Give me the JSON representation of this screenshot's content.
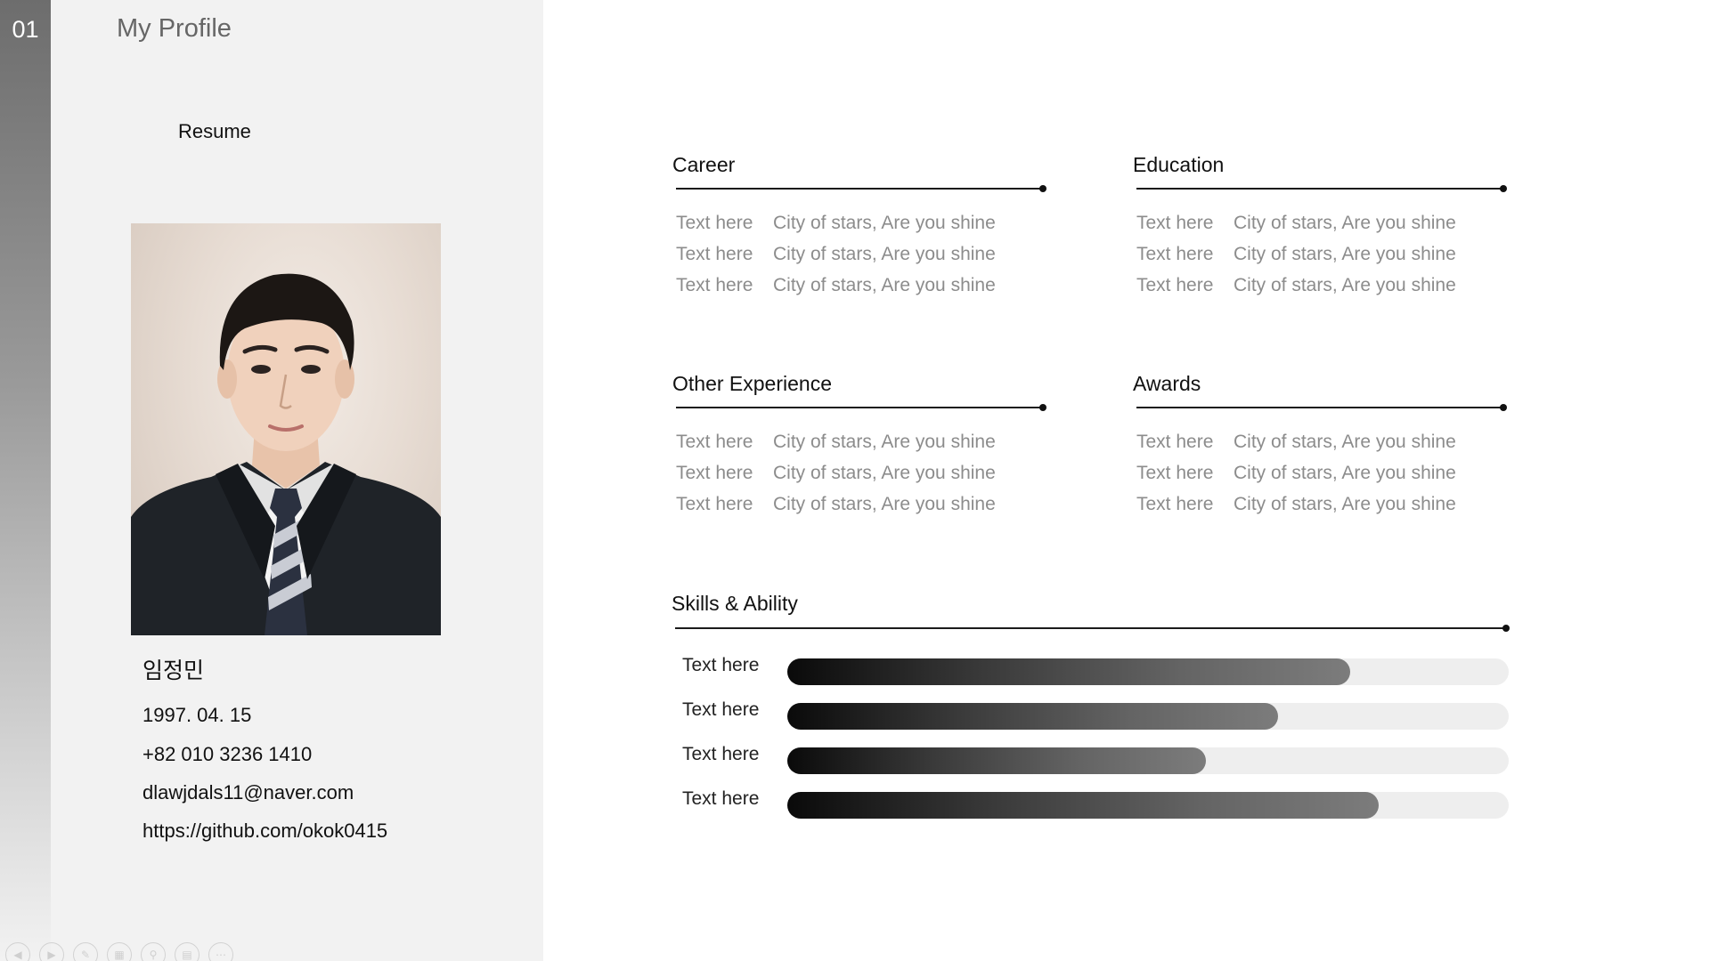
{
  "slide": {
    "number": "01",
    "title": "My Profile"
  },
  "resume_label": "Resume",
  "profile": {
    "name": "임정민",
    "birth": "1997. 04. 15",
    "phone": "+82 010 3236 1410",
    "email": "dlawjdals11@naver.com",
    "github": "https://github.com/okok0415"
  },
  "sections": {
    "career": {
      "title": "Career",
      "rows": [
        {
          "label": "Text here",
          "value": "City of stars, Are you shine"
        },
        {
          "label": "Text here",
          "value": "City of stars, Are you shine"
        },
        {
          "label": "Text here",
          "value": "City of stars, Are you shine"
        }
      ]
    },
    "education": {
      "title": "Education",
      "rows": [
        {
          "label": "Text here",
          "value": "City of stars, Are you shine"
        },
        {
          "label": "Text here",
          "value": "City of stars, Are you shine"
        },
        {
          "label": "Text here",
          "value": "City of stars, Are you shine"
        }
      ]
    },
    "other": {
      "title": "Other Experience",
      "rows": [
        {
          "label": "Text here",
          "value": "City of stars, Are you shine"
        },
        {
          "label": "Text here",
          "value": "City of stars, Are you shine"
        },
        {
          "label": "Text here",
          "value": "City of stars, Are you shine"
        }
      ]
    },
    "awards": {
      "title": "Awards",
      "rows": [
        {
          "label": "Text here",
          "value": "City of stars, Are you shine"
        },
        {
          "label": "Text here",
          "value": "City of stars, Are you shine"
        },
        {
          "label": "Text here",
          "value": "City of stars, Are you shine"
        }
      ]
    }
  },
  "skills": {
    "title": "Skills & Ability",
    "items": [
      {
        "label": "Text here",
        "level": 0.78
      },
      {
        "label": "Text here",
        "level": 0.68
      },
      {
        "label": "Text here",
        "level": 0.58
      },
      {
        "label": "Text here",
        "level": 0.82
      }
    ]
  },
  "toolbar": {
    "icons": [
      "previous-icon",
      "next-icon",
      "pen-icon",
      "slides-icon",
      "zoom-icon",
      "subtitles-icon",
      "more-icon"
    ]
  },
  "colors": {
    "panel_bg": "#f2f2f2",
    "bar_dark": "#0a0a0a",
    "bar_light": "#7c7c7c",
    "track": "#eeeeee",
    "muted_text": "#8c8c8c"
  }
}
